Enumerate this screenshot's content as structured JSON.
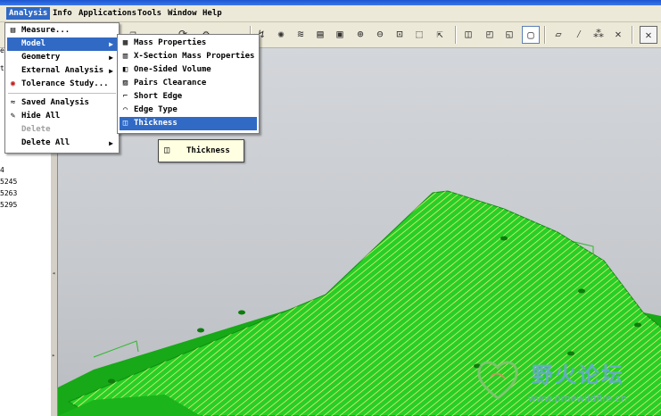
{
  "menubar": {
    "items": [
      "Analysis",
      "Info",
      "Applications",
      "Tools",
      "Window",
      "Help"
    ]
  },
  "analysis_menu": {
    "items": [
      {
        "label": "Measure...",
        "icon": "measure-icon",
        "submenu": false,
        "disabled": false
      },
      {
        "label": "Model",
        "icon": "",
        "submenu": true,
        "disabled": false,
        "highlighted": true
      },
      {
        "label": "Geometry",
        "icon": "",
        "submenu": true,
        "disabled": false
      },
      {
        "label": "External Analysis",
        "icon": "",
        "submenu": true,
        "disabled": false
      },
      {
        "label": "Tolerance Study...",
        "icon": "tolerance-icon",
        "submenu": false,
        "disabled": false
      },
      {
        "label": "Saved Analysis",
        "icon": "saved-analysis-icon",
        "submenu": false,
        "disabled": false
      },
      {
        "label": "Hide All",
        "icon": "hide-all-icon",
        "submenu": false,
        "disabled": false
      },
      {
        "label": "Delete",
        "icon": "",
        "submenu": false,
        "disabled": true
      },
      {
        "label": "Delete All",
        "icon": "",
        "submenu": true,
        "disabled": false
      }
    ]
  },
  "model_submenu": {
    "items": [
      {
        "label": "Mass Properties",
        "icon": "mass-properties-icon"
      },
      {
        "label": "X-Section Mass Properties",
        "icon": "xsection-icon"
      },
      {
        "label": "One-Sided Volume",
        "icon": "one-sided-volume-icon"
      },
      {
        "label": "Pairs Clearance",
        "icon": "pairs-clearance-icon"
      },
      {
        "label": "Short Edge",
        "icon": "short-edge-icon"
      },
      {
        "label": "Edge Type",
        "icon": "edge-type-icon"
      },
      {
        "label": "Thickness",
        "icon": "thickness-icon",
        "highlighted": true
      }
    ]
  },
  "tooltip": {
    "text": "Thickness"
  },
  "left_panel": {
    "lines": [
      "4",
      "5245",
      "5263",
      "5295"
    ],
    "fragments": [
      "el",
      "te"
    ]
  },
  "watermark": {
    "brand": "野火论坛",
    "url": "www.proewildfire.cn"
  },
  "colors": {
    "menu_highlight": "#316ac5",
    "model_green": "#1fc71f",
    "model_line": "#e8e86a",
    "background": "#c6c9cd"
  }
}
